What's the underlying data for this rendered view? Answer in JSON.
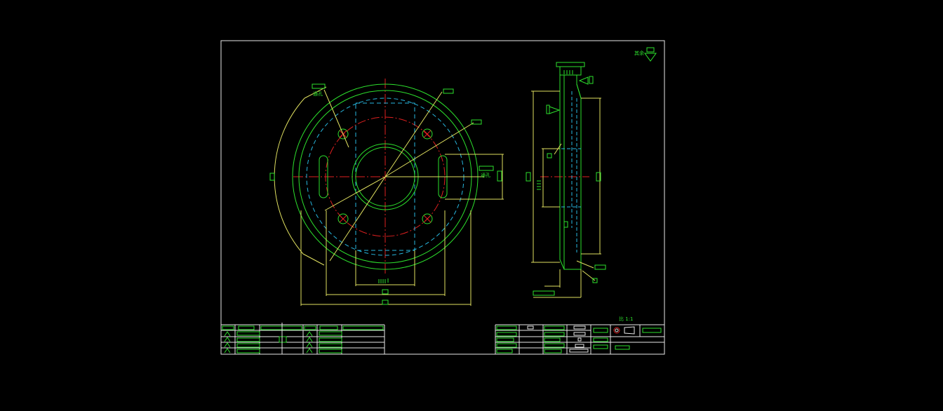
{
  "colors": {
    "background": "#000000",
    "frame": "#e8e8e8",
    "outline_green": "#2de02d",
    "dimension_yellow": "#e0e060",
    "center_red": "#e02020",
    "hidden_cyan": "#28b8e0"
  },
  "annotations": {
    "hole_note_top": "通孔",
    "hole_note_right": "通孔",
    "roughness_corner": "其余",
    "scale_text": "比 1:1"
  }
}
